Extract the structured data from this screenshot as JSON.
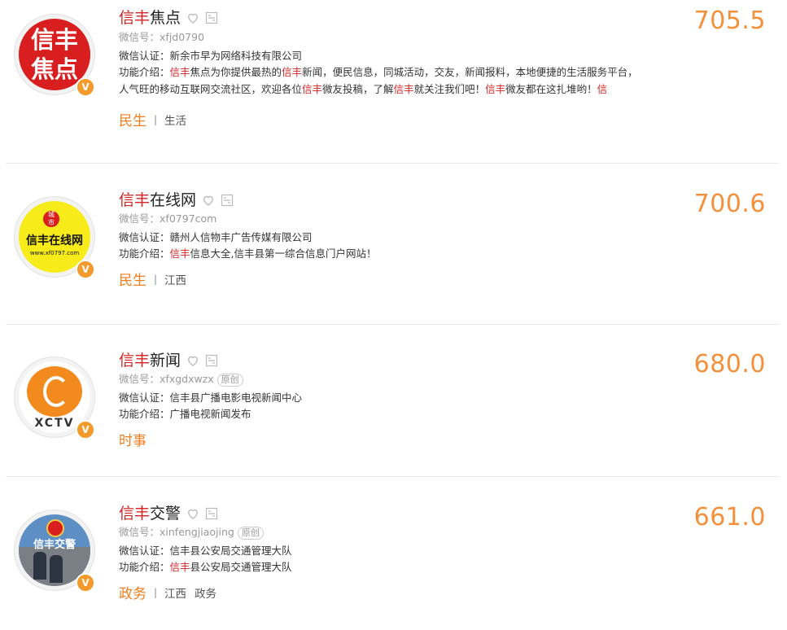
{
  "colors": {
    "accent": "#f07d1f",
    "score": "#f4903a",
    "highlight": "#d62222",
    "badge": "#f39a2b"
  },
  "labels": {
    "wechat_id_prefix": "微信号：",
    "cert_prefix": "微信认证：",
    "intro_prefix": "功能介绍：",
    "original": "原创",
    "v_badge": "V"
  },
  "accounts": [
    {
      "name_hl": "信丰",
      "name_rest": "焦点",
      "wechat_id": "xfjd0790",
      "cert": "新余市早为网络科技有限公司",
      "intro_segments": [
        {
          "t": "信丰",
          "hl": true
        },
        {
          "t": "焦点为你提供最热的",
          "hl": false
        },
        {
          "t": "信丰",
          "hl": true
        },
        {
          "t": "新闻，便民信息，同城活动，交友，新闻报料，本地便捷的生活服务平台，人气旺的移动互联网交流社区，欢迎各位",
          "hl": false
        },
        {
          "t": "信丰",
          "hl": true
        },
        {
          "t": "微友投稿，了解",
          "hl": false
        },
        {
          "t": "信丰",
          "hl": true
        },
        {
          "t": "就关注我们吧！",
          "hl": false
        },
        {
          "t": "信丰",
          "hl": true
        },
        {
          "t": "微友都在这扎堆哟！",
          "hl": false
        },
        {
          "t": "信",
          "hl": true
        }
      ],
      "tag_main": "民生",
      "tags_sub": [
        "生活"
      ],
      "score": "705.5",
      "avatar_icon": "xinfeng-jiaodian-logo",
      "avatar_text": [
        "信丰",
        "焦点"
      ]
    },
    {
      "name_hl": "信丰",
      "name_rest": "在线网",
      "wechat_id": "xf0797com",
      "cert": "赣州人信物丰广告传媒有限公司",
      "intro_segments": [
        {
          "t": "信丰",
          "hl": true
        },
        {
          "t": "信息大全,信丰县第一综合信息门户网站！",
          "hl": false
        }
      ],
      "tag_main": "民生",
      "tags_sub": [
        "江西"
      ],
      "score": "700.6",
      "avatar_icon": "xinfeng-online-logo",
      "avatar_text": [
        "城",
        "市",
        "信丰在线网",
        "www.xf0797.com"
      ]
    },
    {
      "name_hl": "信丰",
      "name_rest": "新闻",
      "wechat_id": "xfxgdxwzx",
      "original": true,
      "cert": "信丰县广播电影电视新闻中心",
      "intro_segments": [
        {
          "t": "广播电视新闻发布",
          "hl": false
        }
      ],
      "tag_main": "时事",
      "tags_sub": [],
      "score": "680.0",
      "avatar_icon": "xinfeng-news-orange-logo",
      "avatar_text": [
        "XCTV"
      ]
    },
    {
      "name_hl": "信丰",
      "name_rest": "交警",
      "wechat_id": "xinfengjiaojing",
      "original": true,
      "cert": "信丰县公安局交通管理大队",
      "intro_segments": [
        {
          "t": "信丰",
          "hl": true
        },
        {
          "t": "县公安局交通管理大队",
          "hl": false
        }
      ],
      "tag_main": "政务",
      "tags_sub": [
        "江西",
        "政务"
      ],
      "score": "661.0",
      "avatar_icon": "traffic-police-photo",
      "avatar_text": [
        "信丰交警"
      ]
    }
  ]
}
